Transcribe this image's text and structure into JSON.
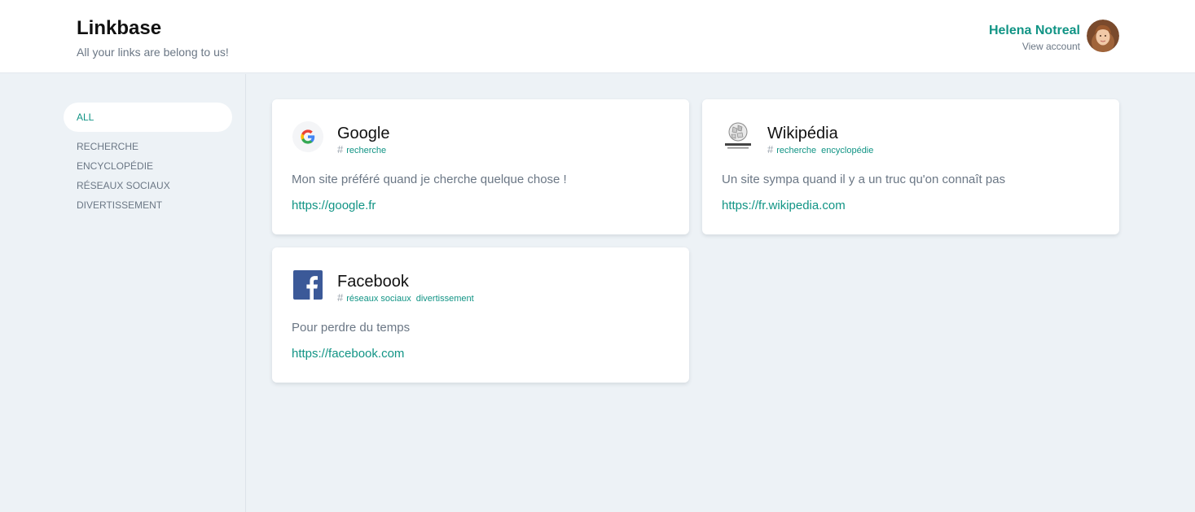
{
  "header": {
    "title": "Linkbase",
    "subtitle": "All your links are belong to us!",
    "user_name": "Helena Notreal",
    "view_account": "View account"
  },
  "sidebar": {
    "all_label": "ALL",
    "items": [
      {
        "label": "RECHERCHE"
      },
      {
        "label": "ENCYCLOPÉDIE"
      },
      {
        "label": "RÉSEAUX SOCIAUX"
      },
      {
        "label": "DIVERTISSEMENT"
      }
    ]
  },
  "links": [
    {
      "title": "Google",
      "tags": [
        "recherche"
      ],
      "description": "Mon site préféré quand je cherche quelque chose !",
      "url": "https://google.fr",
      "icon": "google-icon"
    },
    {
      "title": "Wikipédia",
      "tags": [
        "recherche",
        "encyclopédie"
      ],
      "description": "Un site sympa quand il y a un truc qu'on connaît pas",
      "url": "https://fr.wikipedia.com",
      "icon": "wikipedia-icon"
    },
    {
      "title": "Facebook",
      "tags": [
        "réseaux sociaux",
        "divertissement"
      ],
      "description": "Pour perdre du temps",
      "url": "https://facebook.com",
      "icon": "facebook-icon"
    }
  ],
  "colors": {
    "accent": "#119485",
    "background": "#edf2f6",
    "muted": "#6b7785"
  }
}
